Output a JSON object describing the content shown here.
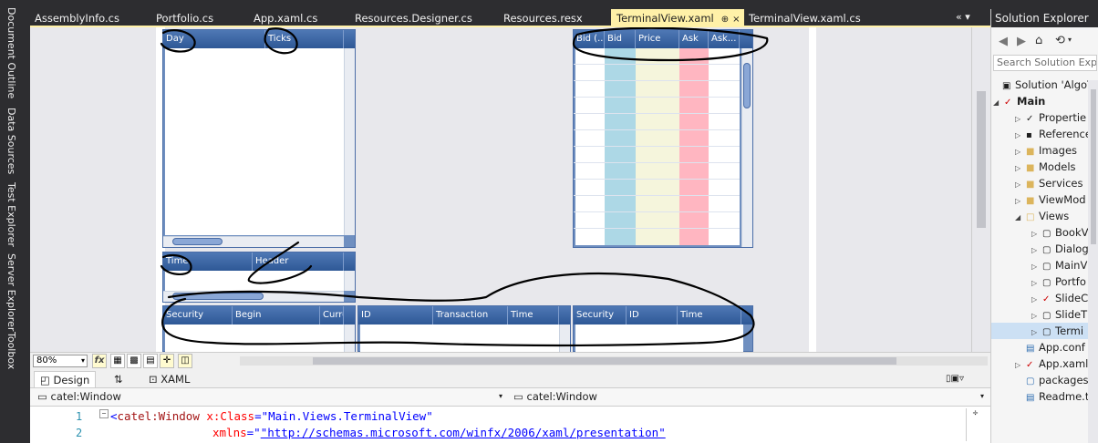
{
  "rail": {
    "items": [
      "Document Outline",
      "Data Sources",
      "Test Explorer",
      "Server Explorer",
      "Toolbox"
    ]
  },
  "tabs": {
    "items": [
      "AssemblyInfo.cs",
      "Portfolio.cs",
      "App.xaml.cs",
      "Resources.Designer.cs",
      "Resources.resx",
      "TerminalView.xaml",
      "TerminalView.xaml.cs"
    ],
    "active_pin": "⊕",
    "active_close": "×",
    "overflow": "«  ▾"
  },
  "grids": {
    "day_ticks": {
      "headers": [
        "Day",
        "Ticks"
      ]
    },
    "time_header": {
      "headers": [
        "Time",
        "Header"
      ]
    },
    "quotes": {
      "headers": [
        "Bid (...",
        "Bid",
        "Price",
        "Ask",
        "Ask..."
      ],
      "colors": {
        "bid": "#add8e6",
        "price": "#f5f5dc",
        "ask": "#ffb6c1"
      }
    },
    "security": {
      "headers": [
        "Security",
        "Begin",
        "Curre"
      ]
    },
    "transaction": {
      "headers": [
        "ID",
        "Transaction",
        "Time"
      ]
    },
    "security_time": {
      "headers": [
        "Security",
        "ID",
        "Time"
      ]
    }
  },
  "zoom": {
    "value": "80%",
    "fx": "fx"
  },
  "design_tabs": {
    "design": "Design",
    "swap": "⇅",
    "xaml": "XAML"
  },
  "combos": {
    "left": "catel:Window",
    "right": "catel:Window"
  },
  "code": {
    "line1_num": "1",
    "line2_num": "2",
    "line1_open": "<",
    "line1_tag": "catel:Window",
    "line1_attr": "x:Class",
    "line1_eq": "=",
    "line1_val": "\"Main.Views.TerminalView\"",
    "line2_attr": "xmlns",
    "line2_eq": "=",
    "line2_val": "\"http://schemas.microsoft.com/winfx/2006/xaml/presentation\""
  },
  "solution_explorer": {
    "title": "Solution Explorer",
    "search_placeholder": "Search Solution Explo",
    "nodes": [
      {
        "label": "Solution 'AlgoTr"
      },
      {
        "label": "Main"
      },
      {
        "label": "Propertie"
      },
      {
        "label": "Reference"
      },
      {
        "label": "Images"
      },
      {
        "label": "Models"
      },
      {
        "label": "Services"
      },
      {
        "label": "ViewMod"
      },
      {
        "label": "Views"
      },
      {
        "label": "BookV"
      },
      {
        "label": "Dialog"
      },
      {
        "label": "MainV"
      },
      {
        "label": "Portfo"
      },
      {
        "label": "SlideC"
      },
      {
        "label": "SlideT"
      },
      {
        "label": "Termi"
      },
      {
        "label": "App.conf"
      },
      {
        "label": "App.xaml"
      },
      {
        "label": "packages"
      },
      {
        "label": "Readme.t"
      }
    ]
  }
}
